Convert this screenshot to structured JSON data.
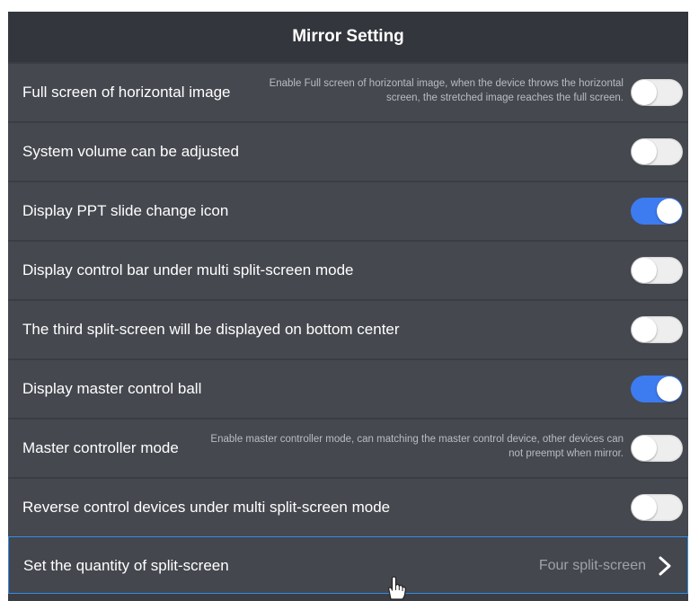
{
  "header": {
    "title": "Mirror Setting"
  },
  "settings": [
    {
      "label": "Full screen of horizontal image",
      "description": "Enable Full screen of horizontal image, when the device throws the horizontal screen, the stretched image reaches the full screen.",
      "enabled": false
    },
    {
      "label": "System volume can be adjusted",
      "description": "",
      "enabled": false
    },
    {
      "label": "Display PPT slide change icon",
      "description": "",
      "enabled": true
    },
    {
      "label": "Display control bar under multi split-screen mode",
      "description": "",
      "enabled": false
    },
    {
      "label": "The third split-screen will be displayed on bottom center",
      "description": "",
      "enabled": false
    },
    {
      "label": "Display master control ball",
      "description": "",
      "enabled": true
    },
    {
      "label": "Master controller mode",
      "description": "Enable master controller mode, can matching the master control device, other devices can not preempt when mirror.",
      "enabled": false
    },
    {
      "label": "Reverse control devices under multi split-screen mode",
      "description": "",
      "enabled": false
    }
  ],
  "split_screen": {
    "label": "Set the quantity of split-screen",
    "value": "Four split-screen",
    "chevron_icon": "chevron-right-icon"
  },
  "colors": {
    "toggle_on": "#3d7bf0",
    "toggle_off": "#eeeeee",
    "selected_border": "#2f8ee8",
    "panel_bg": "#3a3d44",
    "row_bg": "#45484f"
  },
  "cursor": {
    "icon": "hand-pointer-icon"
  }
}
